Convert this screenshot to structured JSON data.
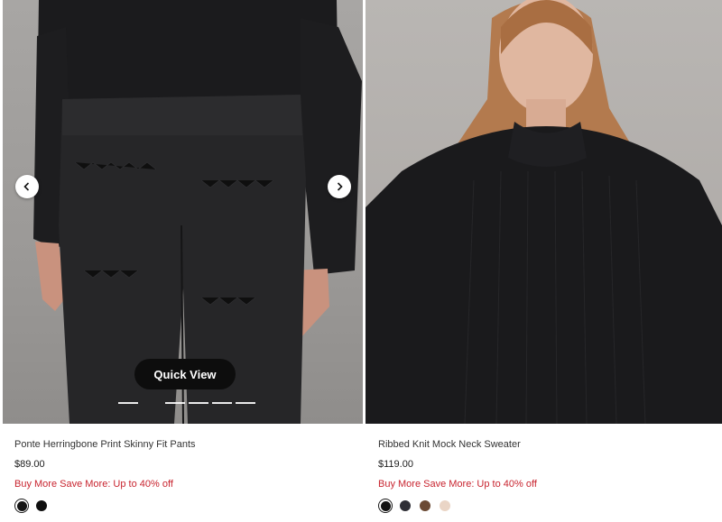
{
  "products": [
    {
      "name": "Ponte Herringbone Print Skinny Fit Pants",
      "price": "$89.00",
      "promo": "Buy More Save More: Up to 40% off",
      "quick_view_label": "Quick View",
      "carousel": {
        "total_slides": 6,
        "active_index": 0
      },
      "swatches": [
        {
          "color": "#141414",
          "selected": true
        },
        {
          "color": "#0f0f0f",
          "selected": false
        }
      ],
      "icons": {
        "prev": "chevron-left-icon",
        "next": "chevron-right-icon"
      }
    },
    {
      "name": "Ribbed Knit Mock Neck Sweater",
      "price": "$119.00",
      "promo": "Buy More Save More: Up to 40% off",
      "swatches": [
        {
          "color": "#121212",
          "selected": true
        },
        {
          "color": "#2f2f36",
          "selected": false
        },
        {
          "color": "#6b4a34",
          "selected": false
        },
        {
          "color": "#ead5c6",
          "selected": false
        }
      ]
    }
  ],
  "colors": {
    "promo": "#c8242f",
    "quick_view_bg": "#0d0d0d"
  }
}
